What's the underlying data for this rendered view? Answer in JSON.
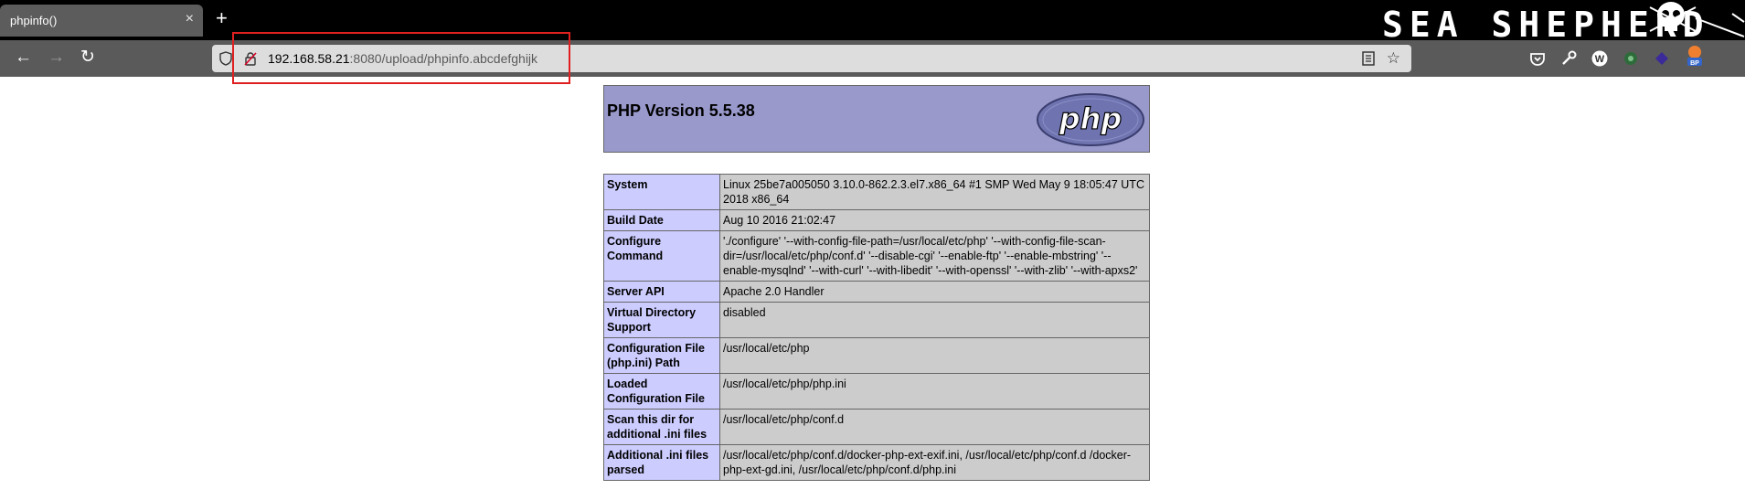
{
  "browser": {
    "tab_title": "phpinfo()",
    "tab_close": "×",
    "new_tab": "+",
    "theme_text": "SEA SHEPHERD",
    "url_host": "192.168.58.21",
    "url_rest": ":8080/upload/phpinfo.abcdefghijk",
    "nav": {
      "back": "←",
      "forward": "→",
      "reload": "↻"
    },
    "star": "☆",
    "extensions": [
      "pocket-icon",
      "wrench-icon",
      "wappalyzer-icon",
      "shield-ext-icon",
      "hackbar-icon",
      "burp-proxy-icon"
    ],
    "colors": {
      "tabstrip": "#000000",
      "toolbar": "#5a5a5a",
      "urlbar": "#dddddd",
      "highlight": "#e02020"
    }
  },
  "phpinfo": {
    "title": "PHP Version 5.5.38",
    "logo_text": "php",
    "colors": {
      "header": "#9999cc",
      "key": "#ccccff",
      "value": "#cccccc"
    },
    "rows": [
      {
        "key": "System",
        "value": "Linux 25be7a005050 3.10.0-862.2.3.el7.x86_64 #1 SMP Wed May 9 18:05:47 UTC 2018 x86_64"
      },
      {
        "key": "Build Date",
        "value": "Aug 10 2016 21:02:47"
      },
      {
        "key": "Configure Command",
        "value": "'./configure' '--with-config-file-path=/usr/local/etc/php' '--with-config-file-scan-dir=/usr/local/etc/php/conf.d' '--disable-cgi' '--enable-ftp' '--enable-mbstring' '--enable-mysqlnd' '--with-curl' '--with-libedit' '--with-openssl' '--with-zlib' '--with-apxs2'"
      },
      {
        "key": "Server API",
        "value": "Apache 2.0 Handler"
      },
      {
        "key": "Virtual Directory Support",
        "value": "disabled"
      },
      {
        "key": "Configuration File (php.ini) Path",
        "value": "/usr/local/etc/php"
      },
      {
        "key": "Loaded Configuration File",
        "value": "/usr/local/etc/php/php.ini"
      },
      {
        "key": "Scan this dir for additional .ini files",
        "value": "/usr/local/etc/php/conf.d"
      },
      {
        "key": "Additional .ini files parsed",
        "value": "/usr/local/etc/php/conf.d/docker-php-ext-exif.ini, /usr/local/etc/php/conf.d /docker-php-ext-gd.ini, /usr/local/etc/php/conf.d/php.ini"
      }
    ]
  }
}
